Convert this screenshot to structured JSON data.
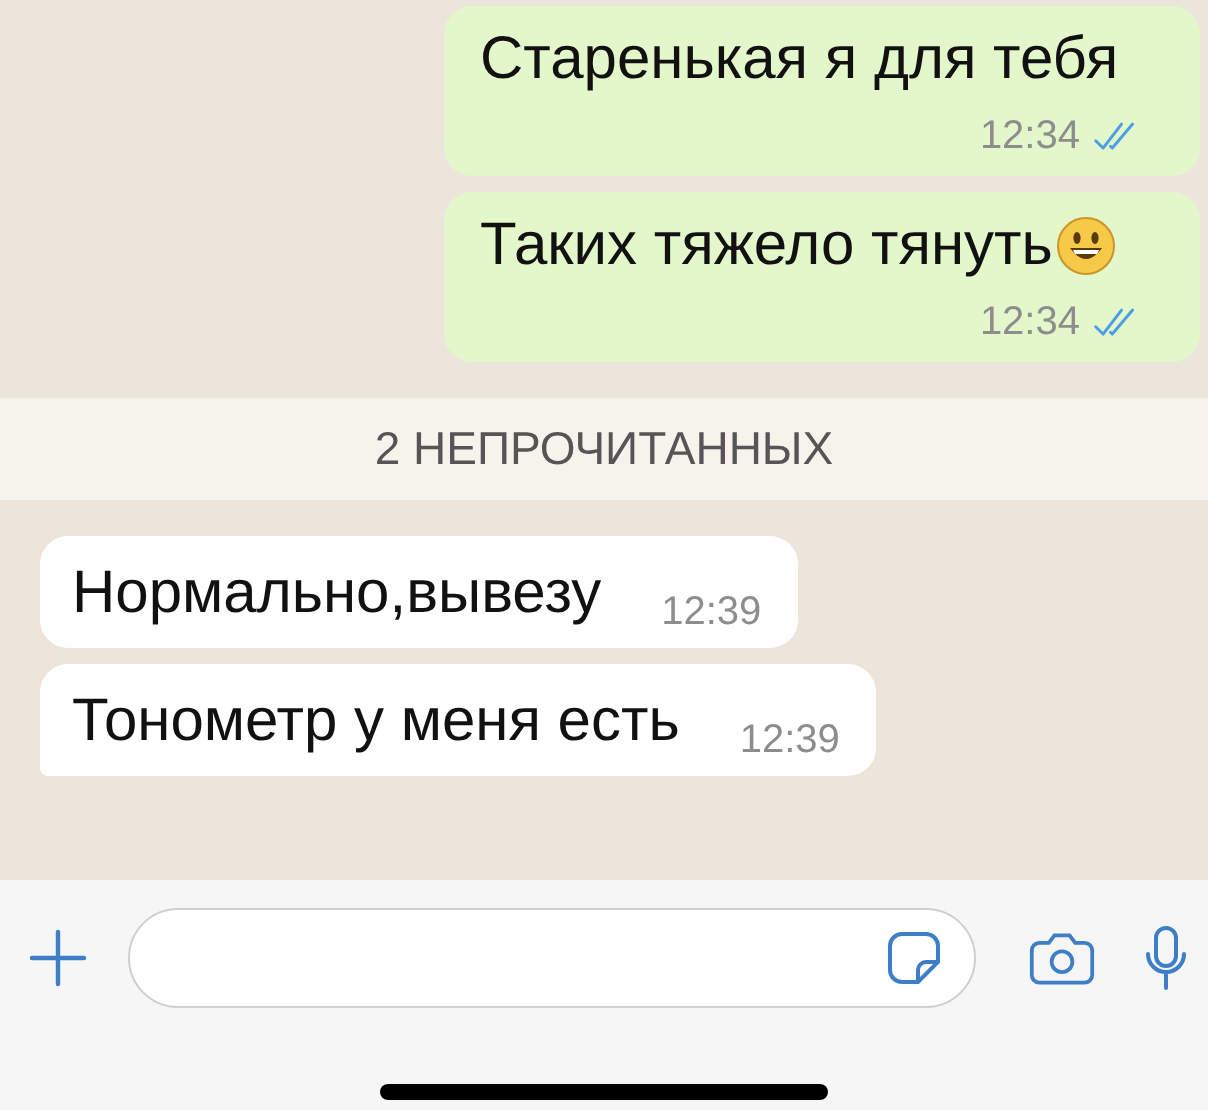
{
  "messages_before": [
    {
      "kind": "outgoing",
      "text": "Старенькая я для тебя",
      "time": "12:34",
      "read": true
    },
    {
      "kind": "outgoing",
      "text": "Таких тяжело тянуть",
      "has_emoji": true,
      "time": "12:34",
      "read": true
    }
  ],
  "unread_banner": "2 НЕПРОЧИТАННЫХ",
  "messages_after": [
    {
      "kind": "incoming",
      "text": "Нормально,вывезу",
      "time": "12:39",
      "tail": false
    },
    {
      "kind": "incoming",
      "text": "Тонометр у меня есть",
      "time": "12:39",
      "tail": true
    }
  ]
}
